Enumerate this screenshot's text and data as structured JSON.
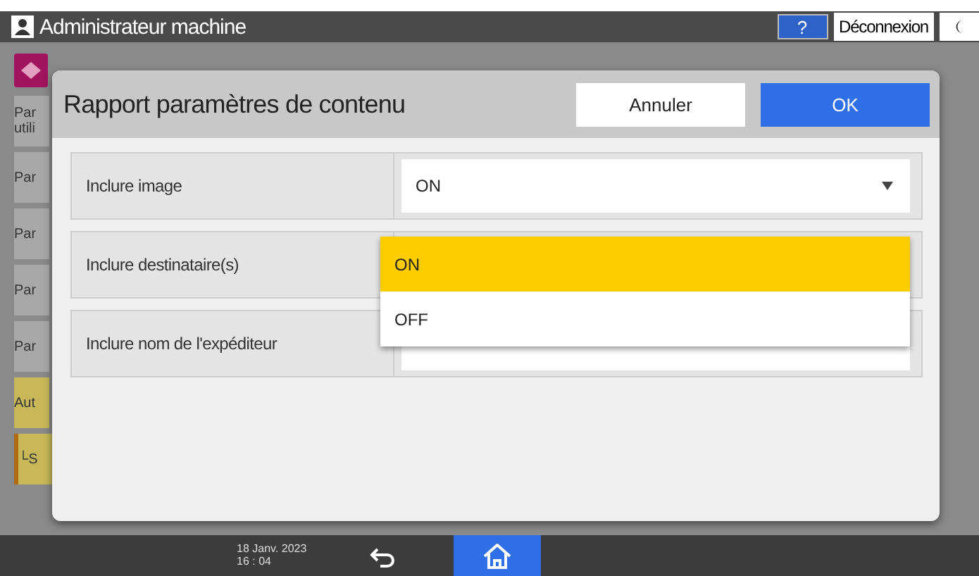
{
  "header": {
    "title": "Administrateur machine",
    "help": "?",
    "logout": "Déconnexion"
  },
  "background_menu": [
    {
      "label": "Par\nutili",
      "kind": "item"
    },
    {
      "label": "Par",
      "kind": "item"
    },
    {
      "label": "Par",
      "kind": "item"
    },
    {
      "label": "Par",
      "kind": "item"
    },
    {
      "label": "Par",
      "kind": "item"
    },
    {
      "label": "Aut",
      "kind": "group"
    },
    {
      "label": "└S",
      "kind": "sub"
    }
  ],
  "dialog": {
    "title": "Rapport paramètres de contenu",
    "buttons": [
      {
        "label": "Annuler",
        "kind": "secondary"
      },
      {
        "label": "OK",
        "kind": "primary"
      }
    ],
    "rows": [
      {
        "label": "Inclure image",
        "value": "ON"
      },
      {
        "label": "Inclure destinataire(s)",
        "options": [
          {
            "label": "ON",
            "selected": true
          },
          {
            "label": "OFF",
            "selected": false
          }
        ]
      },
      {
        "label": "Inclure nom de l'expéditeur"
      }
    ]
  },
  "status_bar": {
    "date": "18 Janv. 2023",
    "time": "16 : 04"
  }
}
